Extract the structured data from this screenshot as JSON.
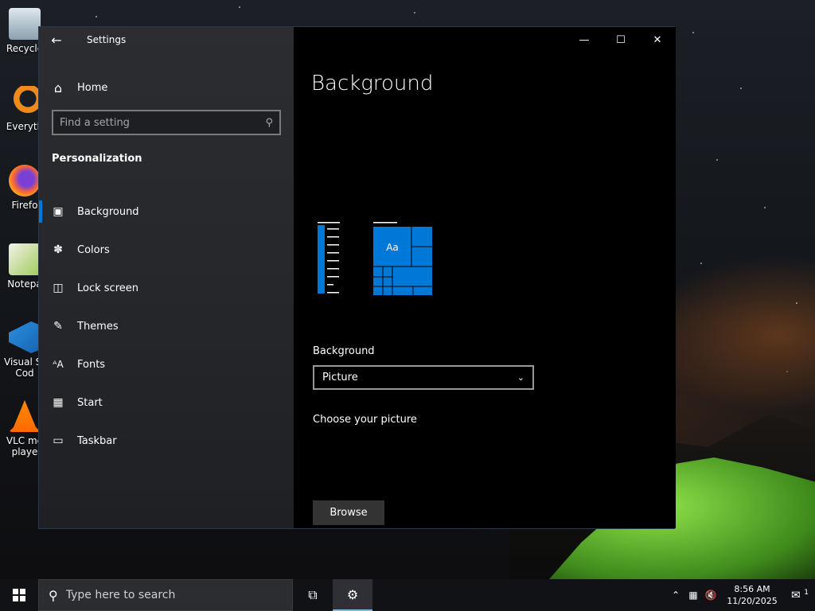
{
  "desktop": {
    "icons": [
      {
        "label": "Recycle",
        "icon": "recycle-bin-icon"
      },
      {
        "label": "Everyth",
        "icon": "everything-search-icon"
      },
      {
        "label": "Firefo",
        "icon": "firefox-icon"
      },
      {
        "label": "Notepa",
        "icon": "notepad-plus-plus-icon"
      },
      {
        "label": "Visual St Cod",
        "icon": "vscode-icon"
      },
      {
        "label": "VLC me playe",
        "icon": "vlc-icon"
      }
    ]
  },
  "settings": {
    "window_title": "Settings",
    "home_label": "Home",
    "search_placeholder": "Find a setting",
    "section_title": "Personalization",
    "nav_items": [
      {
        "label": "Background",
        "icon": "picture-icon"
      },
      {
        "label": "Colors",
        "icon": "palette-icon"
      },
      {
        "label": "Lock screen",
        "icon": "lock-screen-icon"
      },
      {
        "label": "Themes",
        "icon": "themes-icon"
      },
      {
        "label": "Fonts",
        "icon": "fonts-icon"
      },
      {
        "label": "Start",
        "icon": "start-icon"
      },
      {
        "label": "Taskbar",
        "icon": "taskbar-icon"
      }
    ],
    "active_nav": "Background",
    "page_title": "Background",
    "preview_text": "Aa",
    "background_label": "Background",
    "background_value": "Picture",
    "choose_picture_label": "Choose your picture",
    "browse_label": "Browse",
    "accent_color": "#0078d7"
  },
  "taskbar": {
    "search_placeholder": "Type here to search",
    "clock_time": "8:56 AM",
    "clock_date": "11/20/2025",
    "notification_count": "1"
  }
}
